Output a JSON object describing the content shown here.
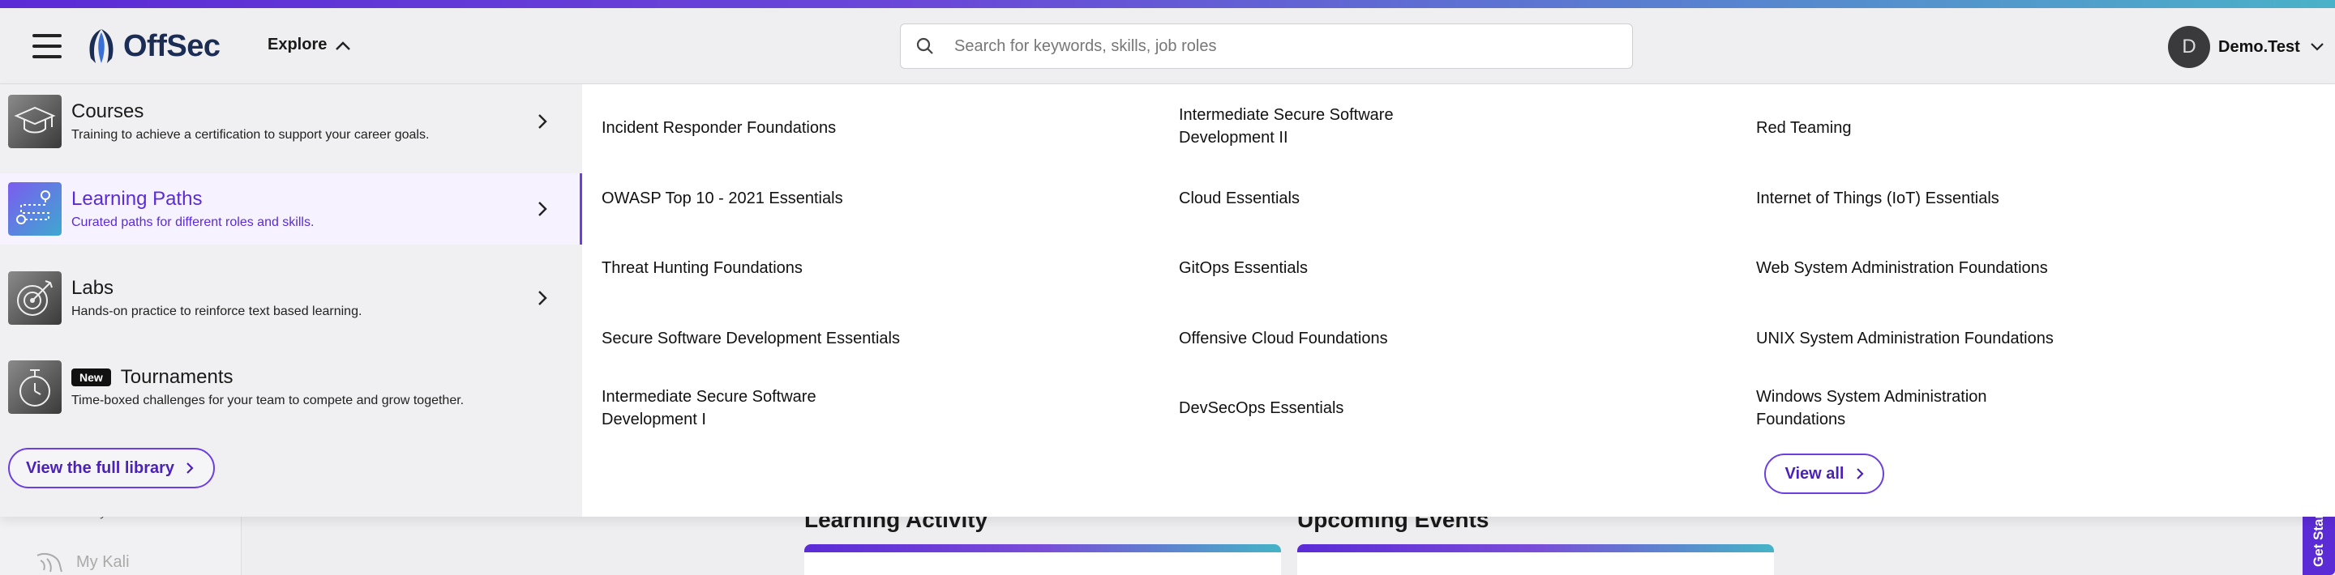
{
  "header": {
    "logo_text": "OffSec",
    "explore_label": "Explore",
    "search_placeholder": "Search for keywords, skills, job roles",
    "avatar_initial": "D",
    "username": "Demo.Test"
  },
  "menu": {
    "items": [
      {
        "title": "Courses",
        "subtitle": "Training to achieve a certification to support your career goals."
      },
      {
        "title": "Learning Paths",
        "subtitle": "Curated paths for different roles and skills."
      },
      {
        "title": "Labs",
        "subtitle": "Hands-on practice to reinforce text based learning."
      },
      {
        "title": "Tournaments",
        "badge": "New",
        "subtitle": "Time-boxed challenges for your team to compete and grow together."
      }
    ],
    "full_library_label": "View the full library"
  },
  "paths": {
    "col1": [
      "Incident Responder Foundations",
      "OWASP Top 10 - 2021 Essentials",
      "Threat Hunting Foundations",
      "Secure Software Development Essentials",
      "Intermediate Secure Software Development I"
    ],
    "col2": [
      "Intermediate Secure Software Development II",
      "Cloud Essentials",
      "GitOps Essentials",
      "Offensive Cloud Foundations",
      "DevSecOps Essentials"
    ],
    "col3": [
      "Red Teaming",
      "Internet of Things (IoT) Essentials",
      "Web System Administration Foundations",
      "UNIX System Administration Foundations",
      "Windows System Administration Foundations"
    ],
    "view_all_label": "View all"
  },
  "background": {
    "connectivity_label": "Connectivity",
    "my_kali_label": "My Kali",
    "learning_activity_title": "Learning Activity",
    "upcoming_events_title": "Upcoming Events",
    "get_started_label": "Get Started"
  },
  "colors": {
    "accent": "#5b2bd6",
    "teal": "#44b4c6"
  }
}
